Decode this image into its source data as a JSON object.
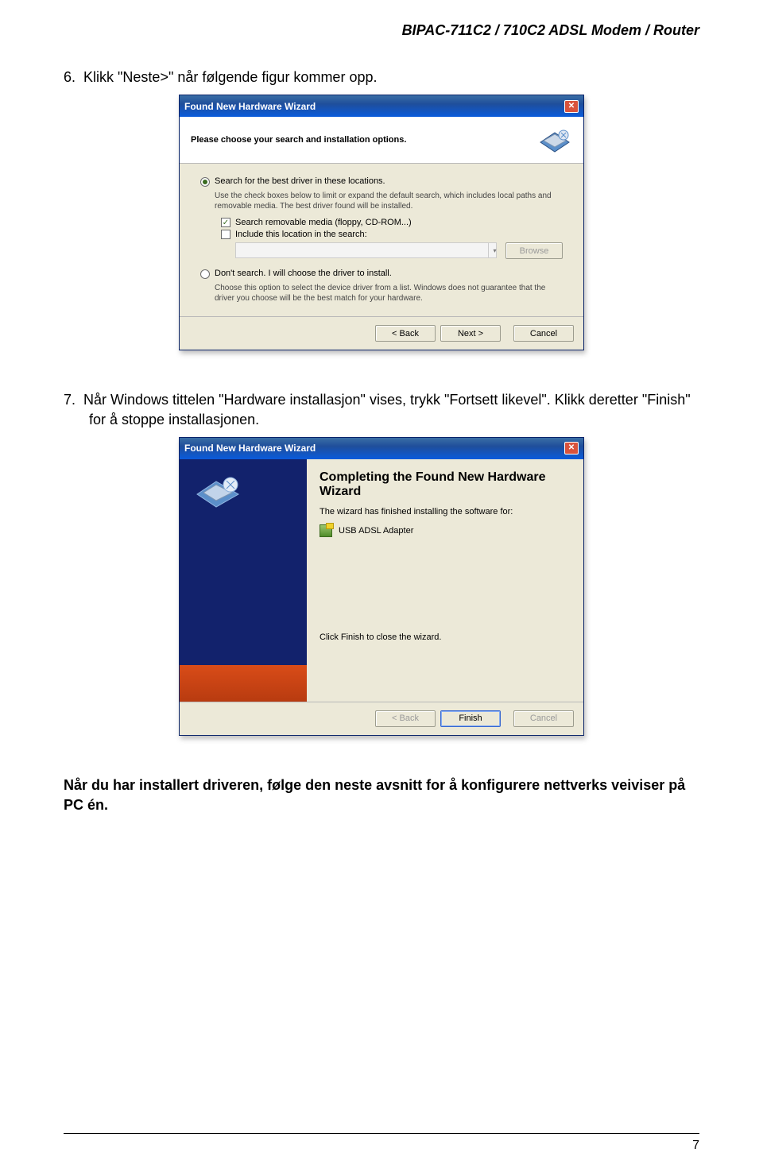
{
  "header": "BIPAC-711C2 / 710C2  ADSL Modem / Router",
  "step6_prefix": "6.",
  "step6": "Klikk \"Neste>\" når følgende figur kommer opp.",
  "step7_prefix": "7.",
  "step7": "Når Windows tittelen \"Hardware installasjon\" vises, trykk \"Fortsett likevel\". Klikk deretter \"Finish\" for å stoppe installasjonen.",
  "conclude": "Når du har installert driveren, følge den neste avsnitt for å konfigurere nettverks veiviser på PC én.",
  "pagenum": "7",
  "wiz1": {
    "title": "Found New Hardware Wizard",
    "subheading": "Please choose your search and installation options.",
    "opt_search": "Search for the best driver in these locations.",
    "opt_search_desc": "Use the check boxes below to limit or expand the default search, which includes local paths and removable media. The best driver found will be installed.",
    "chk_removable": "Search removable media (floppy, CD-ROM...)",
    "chk_location": "Include this location in the search:",
    "browse": "Browse",
    "opt_dont": "Don't search. I will choose the driver to install.",
    "opt_dont_desc": "Choose this option to select the device driver from a list.  Windows does not guarantee that the driver you choose will be the best match for your hardware.",
    "back": "< Back",
    "next": "Next >",
    "cancel": "Cancel"
  },
  "wiz2": {
    "title": "Found New Hardware Wizard",
    "heading": "Completing the Found New Hardware Wizard",
    "finished": "The wizard has finished installing the software for:",
    "device": "USB ADSL Adapter",
    "close_hint": "Click Finish to close the wizard.",
    "back": "< Back",
    "finish": "Finish",
    "cancel": "Cancel"
  }
}
